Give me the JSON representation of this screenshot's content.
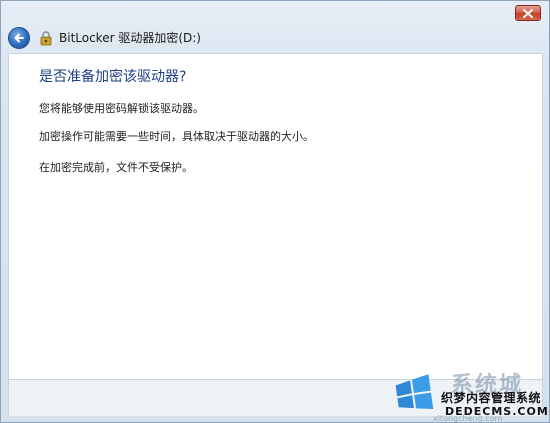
{
  "window": {
    "title": "BitLocker 驱动器加密(D:)",
    "close_icon": "close-icon",
    "back_icon": "back-arrow-icon",
    "app_icon": "bitlocker-key-icon"
  },
  "content": {
    "heading": "是否准备加密该驱动器?",
    "paragraphs": [
      "您将能够使用密码解锁该驱动器。",
      "加密操作可能需要一些时间，具体取决于驱动器的大小。",
      "在加密完成前，文件不受保护。"
    ]
  },
  "watermark": {
    "brand": "系统城",
    "cn_text": "织梦内容管理系统",
    "site": "DEDECMS.COM",
    "sub": "xitongcheng.com",
    "logo_icon": "windows-logo-icon"
  },
  "colors": {
    "heading": "#1e3f86",
    "close_button": "#c23d24",
    "back_button": "#2c6cc0"
  }
}
